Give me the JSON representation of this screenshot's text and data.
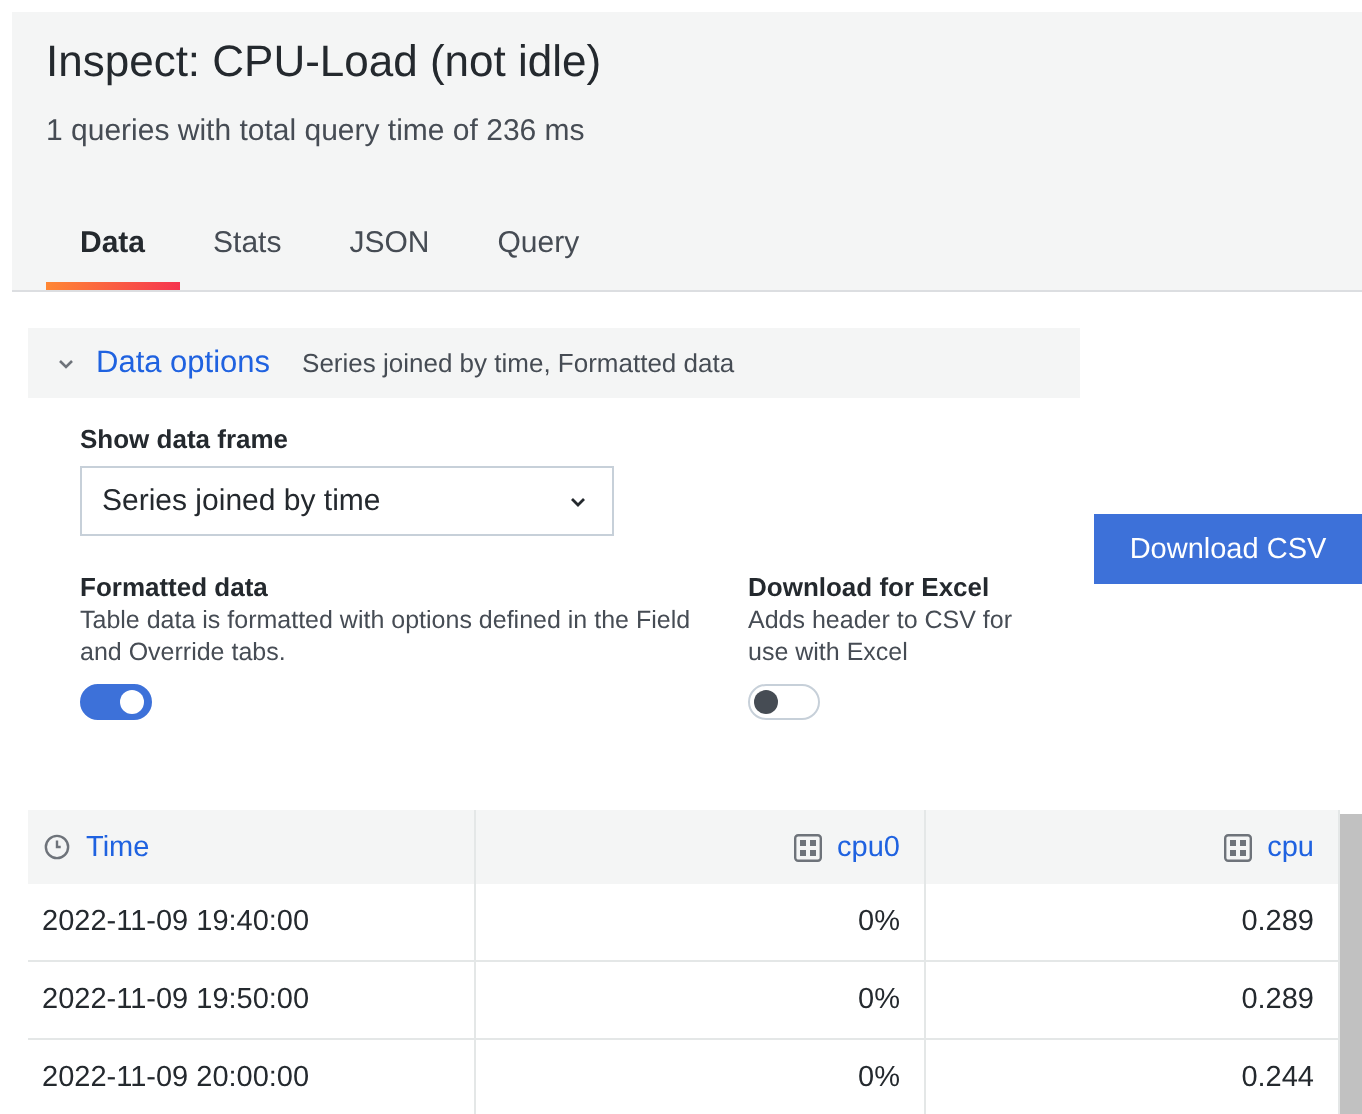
{
  "title": "Inspect: CPU-Load (not idle)",
  "subtitle": "1 queries with total query time of 236 ms",
  "tabs": [
    {
      "label": "Data",
      "selected": true
    },
    {
      "label": "Stats",
      "selected": false
    },
    {
      "label": "JSON",
      "selected": false
    },
    {
      "label": "Query",
      "selected": false
    }
  ],
  "data_options": {
    "label": "Data options",
    "expanded": true,
    "summary": "Series joined by time, Formatted data",
    "show_data_frame": {
      "label": "Show data frame",
      "value": "Series joined by time"
    },
    "switches": [
      {
        "label": "Formatted data",
        "description": "Table data is formatted with options defined in the Field and Override tabs.",
        "on": true
      },
      {
        "label": "Download for Excel",
        "description": "Adds header to CSV for use with Excel",
        "on": false
      }
    ]
  },
  "download_button": "Download CSV",
  "table": {
    "columns": [
      {
        "label": "Time",
        "kind": "time"
      },
      {
        "label": "cpu0",
        "kind": "number"
      },
      {
        "label": "cpu",
        "kind": "number"
      }
    ],
    "rows": [
      [
        "2022-11-09 19:40:00",
        "0%",
        "0.289"
      ],
      [
        "2022-11-09 19:50:00",
        "0%",
        "0.289"
      ],
      [
        "2022-11-09 20:00:00",
        "0%",
        "0.244"
      ]
    ]
  }
}
